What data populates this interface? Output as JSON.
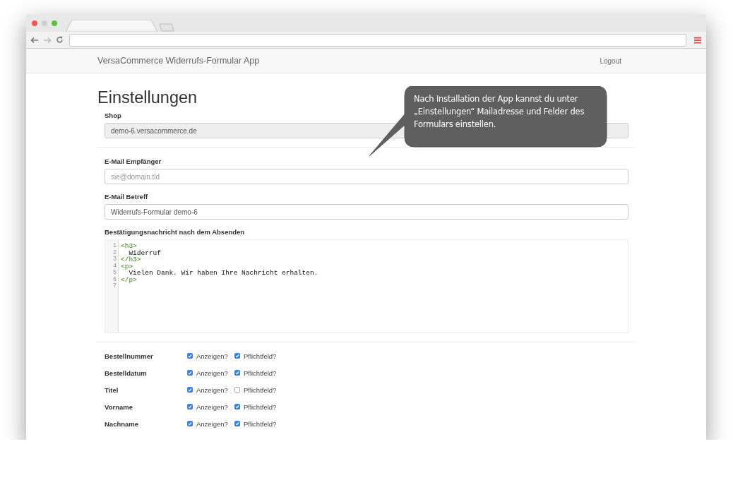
{
  "navbar": {
    "brand": "VersaCommerce Widerrufs-Formular App",
    "logout": "Logout"
  },
  "heading": "Einstellungen",
  "fields": [
    {
      "label": "Shop",
      "kind": "readonly",
      "value": "demo-6.versacommerce.de"
    },
    {
      "label": "E-Mail Empfänger",
      "kind": "input",
      "placeholder": "sie@domain.tld"
    },
    {
      "label": "E-Mail Betreff",
      "kind": "input",
      "value": "Widerrufs-Formular demo-6"
    }
  ],
  "editor": {
    "label": "Bestätigungsnachricht nach dem Absenden",
    "lines": [
      {
        "number": "1",
        "kind": "tag",
        "text": "<h3>"
      },
      {
        "number": "2",
        "kind": "text",
        "text": "  Widerruf"
      },
      {
        "number": "3",
        "kind": "tag",
        "text": "</h3>"
      },
      {
        "number": "4",
        "kind": "tag",
        "text": "<p>"
      },
      {
        "number": "5",
        "kind": "text",
        "text": "  Vielen Dank. Wir haben Ihre Nachricht erhalten."
      },
      {
        "number": "6",
        "kind": "tag",
        "text": "</p>"
      },
      {
        "number": "7",
        "kind": "empty"
      }
    ]
  },
  "form_fields": [
    {
      "label": "Bestellnummer",
      "show": {
        "label": "Anzeigen?",
        "checked": true
      },
      "required": {
        "label": "Pflichtfeld?",
        "checked": true
      }
    },
    {
      "label": "Bestelldatum",
      "show": {
        "label": "Anzeigen?",
        "checked": true
      },
      "required": {
        "label": "Pflichtfeld?",
        "checked": true
      }
    },
    {
      "label": "Titel",
      "show": {
        "label": "Anzeigen?",
        "checked": true
      },
      "required": {
        "label": "Pflichtfeld?",
        "checked": false
      }
    },
    {
      "label": "Vorname",
      "show": {
        "label": "Anzeigen?",
        "checked": true
      },
      "required": {
        "label": "Pflichtfeld?",
        "checked": true
      }
    },
    {
      "label": "Nachname",
      "show": {
        "label": "Anzeigen?",
        "checked": true
      },
      "required": {
        "label": "Pflichtfeld?",
        "checked": true
      }
    }
  ],
  "callout": {
    "text": "Nach Installation der App kannst du unter „Einstellungen“ Mailadresse und Felder des Formulars einstellen."
  }
}
